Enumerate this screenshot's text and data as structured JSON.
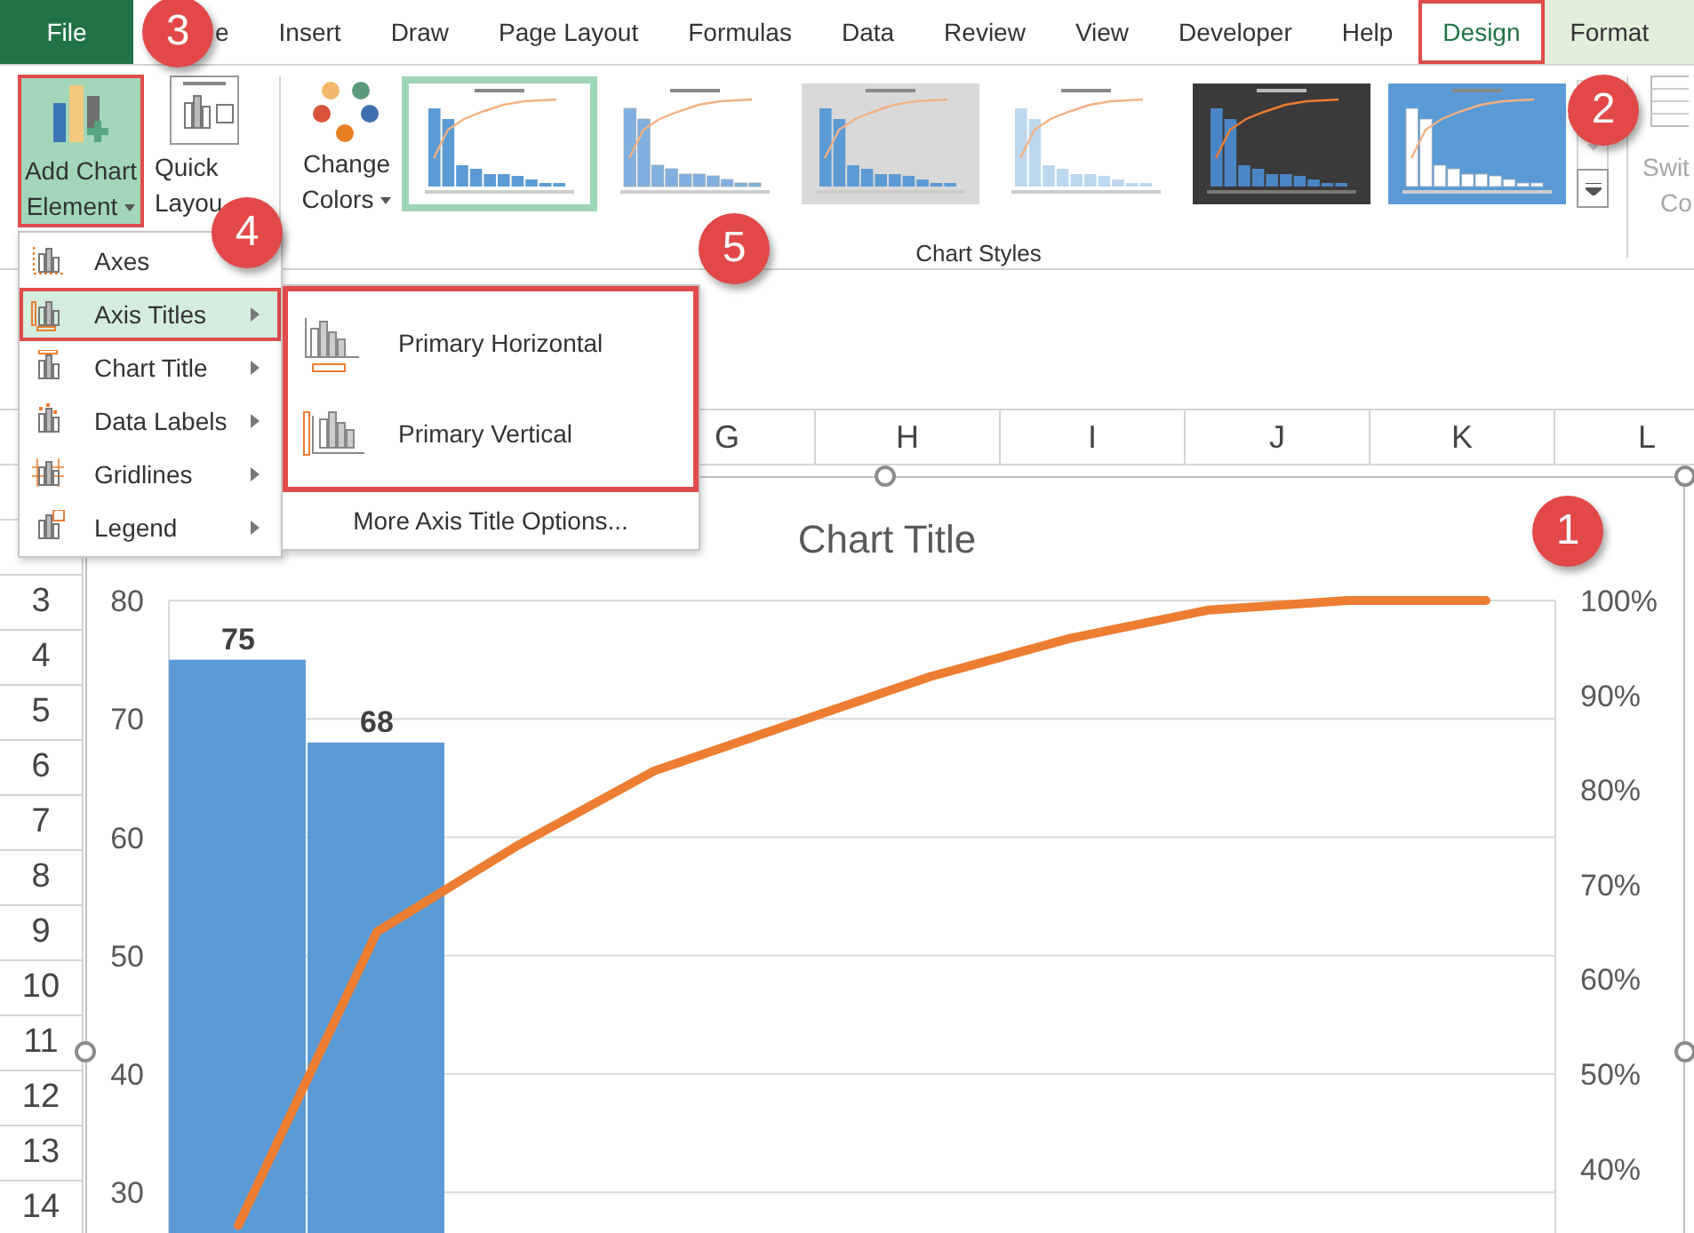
{
  "ribbon_tabs": [
    {
      "label": "File",
      "kind": "file",
      "selected": false,
      "highlighted": false
    },
    {
      "label": "e",
      "kind": "tab",
      "selected": false,
      "highlighted": false
    },
    {
      "label": "Insert",
      "kind": "tab",
      "selected": false,
      "highlighted": false
    },
    {
      "label": "Draw",
      "kind": "tab",
      "selected": false,
      "highlighted": false
    },
    {
      "label": "Page Layout",
      "kind": "tab",
      "selected": false,
      "highlighted": false
    },
    {
      "label": "Formulas",
      "kind": "tab",
      "selected": false,
      "highlighted": false
    },
    {
      "label": "Data",
      "kind": "tab",
      "selected": false,
      "highlighted": false
    },
    {
      "label": "Review",
      "kind": "tab",
      "selected": false,
      "highlighted": false
    },
    {
      "label": "View",
      "kind": "tab",
      "selected": false,
      "highlighted": false
    },
    {
      "label": "Developer",
      "kind": "tab",
      "selected": false,
      "highlighted": false
    },
    {
      "label": "Help",
      "kind": "tab",
      "selected": false,
      "highlighted": false
    },
    {
      "label": "Design",
      "kind": "tab",
      "selected": true,
      "highlighted": true
    },
    {
      "label": "Format",
      "kind": "contextual",
      "selected": false,
      "highlighted": false
    }
  ],
  "ribbon": {
    "add_chart_element": {
      "label": "Add Chart Element",
      "highlighted": true
    },
    "quick_layout": {
      "label": "Quick Layou"
    },
    "change_colors": {
      "label": "Change Colors"
    },
    "chart_styles": {
      "label": "Chart Styles",
      "styles": [
        {
          "kind": "plain",
          "selected": true
        },
        {
          "kind": "banded",
          "selected": false
        },
        {
          "kind": "gray",
          "selected": false
        },
        {
          "kind": "faded",
          "selected": false
        },
        {
          "kind": "dark",
          "selected": false
        },
        {
          "kind": "hatched",
          "selected": false
        }
      ]
    },
    "switch_row_column": {
      "label_lines": [
        "Swit",
        "Co"
      ],
      "disabled": true
    }
  },
  "chart_element_menu": {
    "items": [
      {
        "label": "Axes",
        "submenu": false,
        "selected": false
      },
      {
        "label": "Axis Titles",
        "submenu": true,
        "selected": true
      },
      {
        "label": "Chart Title",
        "submenu": true,
        "selected": false
      },
      {
        "label": "Data Labels",
        "submenu": true,
        "selected": false
      },
      {
        "label": "Gridlines",
        "submenu": true,
        "selected": false
      },
      {
        "label": "Legend",
        "submenu": true,
        "selected": false
      }
    ]
  },
  "axis_titles_submenu": {
    "highlighted": true,
    "items": [
      {
        "label": "Primary Horizontal"
      },
      {
        "label": "Primary Vertical"
      }
    ],
    "more_options": "More Axis Title Options..."
  },
  "sheet": {
    "columns": [
      "G",
      "H",
      "I",
      "J",
      "K",
      "L"
    ],
    "rows": [
      "3",
      "4",
      "5",
      "6",
      "7",
      "8",
      "9",
      "10",
      "11",
      "12",
      "13",
      "14"
    ]
  },
  "chart": {
    "title": "Chart Title",
    "bars": {
      "chart_data": {
        "type": "bar",
        "ylim": [
          0,
          80
        ],
        "yticks": [
          30,
          40,
          50,
          60,
          70,
          80
        ],
        "grid": true,
        "data_labels": true,
        "series": [
          {
            "color": "#5b9bd5",
            "values": [
              75,
              68,
              null,
              null,
              null,
              null,
              null,
              null,
              null,
              null
            ]
          }
        ]
      }
    },
    "cumulative_line": {
      "chart_data": {
        "type": "line",
        "ylim": [
          0,
          1
        ],
        "yticks": [
          {
            "value": 0.4,
            "label": "40%"
          },
          {
            "value": 0.5,
            "label": "50%"
          },
          {
            "value": 0.6,
            "label": "60%"
          },
          {
            "value": 0.7,
            "label": "70%"
          },
          {
            "value": 0.8,
            "label": "80%"
          },
          {
            "value": 0.9,
            "label": "90%"
          },
          {
            "value": 1.0,
            "label": "100%"
          }
        ],
        "series": [
          {
            "color": "#ed7d31",
            "values": [
              0.34,
              0.65,
              0.74,
              0.82,
              0.87,
              0.92,
              0.96,
              0.99,
              1.0,
              1.0
            ]
          }
        ]
      }
    }
  },
  "callouts": [
    "3",
    "2",
    "4",
    "5",
    "1"
  ]
}
